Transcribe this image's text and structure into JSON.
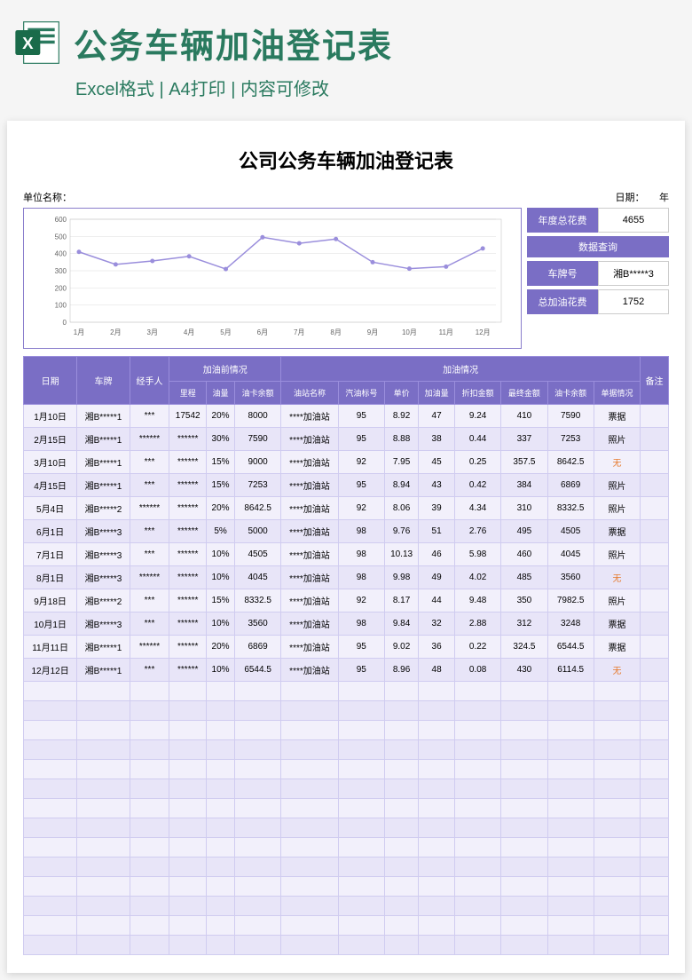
{
  "header": {
    "title": "公务车辆加油登记表",
    "subtitle": "Excel格式 | A4打印 | 内容可修改"
  },
  "sheet": {
    "title": "公司公务车辆加油登记表",
    "unit_label": "单位名称：",
    "date_label": "日期：　　年"
  },
  "summary": {
    "annual_label": "年度总花费",
    "annual_value": "4655",
    "query_header": "数据查询",
    "plate_label": "车牌号",
    "plate_value": "湘B*****3",
    "total_label": "总加油花费",
    "total_value": "1752"
  },
  "chart_data": {
    "type": "line",
    "title": "",
    "xlabel": "",
    "ylabel": "",
    "ylim": [
      0,
      600
    ],
    "yticks": [
      0,
      100,
      200,
      300,
      400,
      500,
      600
    ],
    "categories": [
      "1月",
      "2月",
      "3月",
      "4月",
      "5月",
      "6月",
      "7月",
      "8月",
      "9月",
      "10月",
      "11月",
      "12月"
    ],
    "values": [
      410,
      337,
      357,
      384,
      310,
      495,
      460,
      485,
      350,
      312,
      324,
      430
    ]
  },
  "table": {
    "headers": {
      "date": "日期",
      "plate": "车牌",
      "handler": "经手人",
      "before_group": "加油前情况",
      "mileage": "里程",
      "fuel_level": "油量",
      "card_balance": "油卡余额",
      "after_group": "加油情况",
      "station": "油站名称",
      "grade": "汽油标号",
      "price": "单价",
      "amount": "加油量",
      "discount": "折扣金额",
      "final": "最终金额",
      "card_after": "油卡余额",
      "receipt": "单据情况",
      "note": "备注"
    },
    "rows": [
      {
        "date": "1月10日",
        "plate": "湘B*****1",
        "handler": "***",
        "mileage": "17542",
        "fuel": "20%",
        "balance": "8000",
        "station": "****加油站",
        "grade": "95",
        "price": "8.92",
        "amount": "47",
        "discount": "9.24",
        "final": "410",
        "after": "7590",
        "receipt": "票据"
      },
      {
        "date": "2月15日",
        "plate": "湘B*****1",
        "handler": "******",
        "mileage": "******",
        "fuel": "30%",
        "balance": "7590",
        "station": "****加油站",
        "grade": "95",
        "price": "8.88",
        "amount": "38",
        "discount": "0.44",
        "final": "337",
        "after": "7253",
        "receipt": "照片"
      },
      {
        "date": "3月10日",
        "plate": "湘B*****1",
        "handler": "***",
        "mileage": "******",
        "fuel": "15%",
        "balance": "9000",
        "station": "****加油站",
        "grade": "92",
        "price": "7.95",
        "amount": "45",
        "discount": "0.25",
        "final": "357.5",
        "after": "8642.5",
        "receipt": "无",
        "red": true
      },
      {
        "date": "4月15日",
        "plate": "湘B*****1",
        "handler": "***",
        "mileage": "******",
        "fuel": "15%",
        "balance": "7253",
        "station": "****加油站",
        "grade": "95",
        "price": "8.94",
        "amount": "43",
        "discount": "0.42",
        "final": "384",
        "after": "6869",
        "receipt": "照片"
      },
      {
        "date": "5月4日",
        "plate": "湘B*****2",
        "handler": "******",
        "mileage": "******",
        "fuel": "20%",
        "balance": "8642.5",
        "station": "****加油站",
        "grade": "92",
        "price": "8.06",
        "amount": "39",
        "discount": "4.34",
        "final": "310",
        "after": "8332.5",
        "receipt": "照片"
      },
      {
        "date": "6月1日",
        "plate": "湘B*****3",
        "handler": "***",
        "mileage": "******",
        "fuel": "5%",
        "balance": "5000",
        "station": "****加油站",
        "grade": "98",
        "price": "9.76",
        "amount": "51",
        "discount": "2.76",
        "final": "495",
        "after": "4505",
        "receipt": "票据"
      },
      {
        "date": "7月1日",
        "plate": "湘B*****3",
        "handler": "***",
        "mileage": "******",
        "fuel": "10%",
        "balance": "4505",
        "station": "****加油站",
        "grade": "98",
        "price": "10.13",
        "amount": "46",
        "discount": "5.98",
        "final": "460",
        "after": "4045",
        "receipt": "照片"
      },
      {
        "date": "8月1日",
        "plate": "湘B*****3",
        "handler": "******",
        "mileage": "******",
        "fuel": "10%",
        "balance": "4045",
        "station": "****加油站",
        "grade": "98",
        "price": "9.98",
        "amount": "49",
        "discount": "4.02",
        "final": "485",
        "after": "3560",
        "receipt": "无",
        "red": true
      },
      {
        "date": "9月18日",
        "plate": "湘B*****2",
        "handler": "***",
        "mileage": "******",
        "fuel": "15%",
        "balance": "8332.5",
        "station": "****加油站",
        "grade": "92",
        "price": "8.17",
        "amount": "44",
        "discount": "9.48",
        "final": "350",
        "after": "7982.5",
        "receipt": "照片"
      },
      {
        "date": "10月1日",
        "plate": "湘B*****3",
        "handler": "***",
        "mileage": "******",
        "fuel": "10%",
        "balance": "3560",
        "station": "****加油站",
        "grade": "98",
        "price": "9.84",
        "amount": "32",
        "discount": "2.88",
        "final": "312",
        "after": "3248",
        "receipt": "票据"
      },
      {
        "date": "11月11日",
        "plate": "湘B*****1",
        "handler": "******",
        "mileage": "******",
        "fuel": "20%",
        "balance": "6869",
        "station": "****加油站",
        "grade": "95",
        "price": "9.02",
        "amount": "36",
        "discount": "0.22",
        "final": "324.5",
        "after": "6544.5",
        "receipt": "票据"
      },
      {
        "date": "12月12日",
        "plate": "湘B*****1",
        "handler": "***",
        "mileage": "******",
        "fuel": "10%",
        "balance": "6544.5",
        "station": "****加油站",
        "grade": "95",
        "price": "8.96",
        "amount": "48",
        "discount": "0.08",
        "final": "430",
        "after": "6114.5",
        "receipt": "无",
        "red": true
      }
    ],
    "empty_rows": 14
  }
}
